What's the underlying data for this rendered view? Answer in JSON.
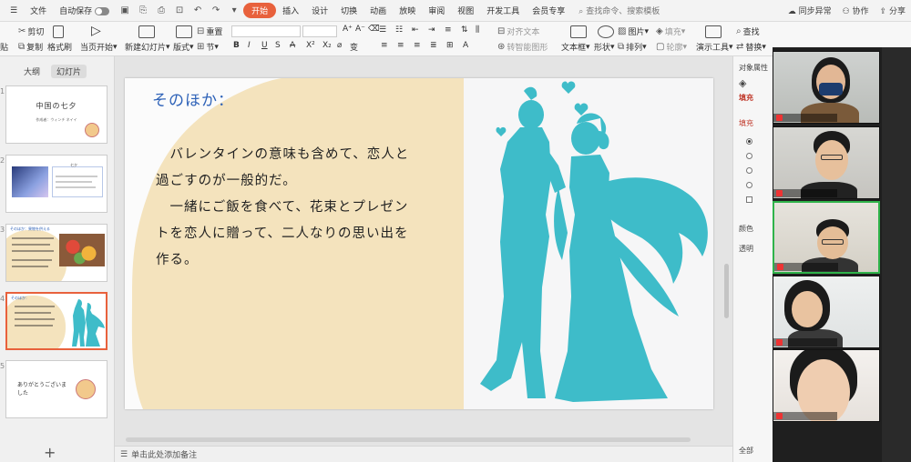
{
  "menu": {
    "file": "文件",
    "autosave": "自动保存",
    "tabs": [
      "开始",
      "插入",
      "设计",
      "切换",
      "动画",
      "放映",
      "审阅",
      "视图",
      "开发工具",
      "会员专享"
    ],
    "active_tab": "开始",
    "search_placeholder": "查找命令、搜索模板",
    "sync": "同步异常",
    "collab": "协作",
    "share": "分享"
  },
  "ribbon": {
    "paste": "贴",
    "cut": "剪切",
    "copy": "复制",
    "format_painter": "格式刷",
    "from_current": "当页开始",
    "new_slide": "新建幻灯片",
    "layout": "版式",
    "section": "节",
    "reset": "重置",
    "align_text": "对齐文本",
    "smart_art": "转智能图形",
    "textbox": "文本框",
    "shape": "形状",
    "picture": "图片",
    "arrange": "排列",
    "fill": "填充",
    "outline": "轮廓",
    "slideshow_tools": "演示工具",
    "find": "查找",
    "replace": "替换",
    "select": "选择"
  },
  "left_panel": {
    "tab_outline": "大纲",
    "tab_slides": "幻灯片",
    "thumbnails": [
      {
        "num": "1",
        "title": "中国の七夕",
        "subtitle": "作成者：ウィンチ ネイイ"
      },
      {
        "num": "2",
        "title": "七夕"
      },
      {
        "num": "3",
        "title": "そのほか：果物を供える"
      },
      {
        "num": "4",
        "title": "そのほか："
      },
      {
        "num": "5",
        "title": "ありがとうございました"
      }
    ]
  },
  "slide": {
    "title": "そのほか：",
    "paragraphs": [
      "　バレンタインの意味も含めて、恋人と過ごすのが一般的だ。",
      "　一緒にご飯を食べて、花束とプレゼントを恋人に贈って、二人なりの思い出を作る。"
    ],
    "beige": "#f4e3bd",
    "silhouette": "#3ebcc9"
  },
  "notes": {
    "placeholder": "单击此处添加备注"
  },
  "props_panel": {
    "title": "对象属性",
    "fill_tab": "填充",
    "fill_header": "填充",
    "color": "颜色",
    "transparency": "透明",
    "all": "全部"
  }
}
